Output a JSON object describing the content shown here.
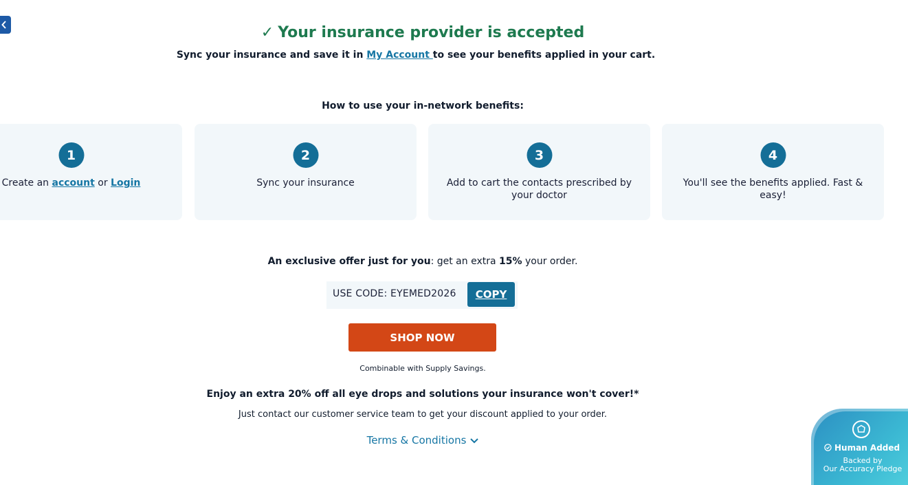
{
  "hero": {
    "check": "✓",
    "title": "Your insurance provider is accepted",
    "sub_before": "Sync your insurance and save it in ",
    "sub_link": "My Account ",
    "sub_after": "to see your benefits applied in your cart."
  },
  "how": {
    "title": "How to use your in-network benefits:",
    "steps": [
      {
        "num": "1",
        "pre": "Create an ",
        "link1": "account",
        "mid": " or ",
        "link2": "Login"
      },
      {
        "num": "2",
        "text": "Sync your insurance"
      },
      {
        "num": "3",
        "text": "Add to cart the contacts prescribed by your doctor"
      },
      {
        "num": "4",
        "text": "You'll see the benefits applied. Fast & easy!"
      }
    ]
  },
  "offer": {
    "bold1": "An exclusive offer just for you",
    "text1": ": get an extra ",
    "bold2": "15%",
    "text2": " your order.",
    "code": "USE CODE: EYEMED2026",
    "copy_label": "COPY"
  },
  "shop_label": "SHOP NOW",
  "combinable": "Combinable with Supply Savings.",
  "enjoy": "Enjoy an extra 20% off all eye drops and solutions your insurance won't cover!*",
  "contact": "Just contact our customer service team to get your discount applied to your order.",
  "terms": "Terms & Conditions",
  "badge": {
    "title": "Human Added",
    "sub1": "Backed by",
    "sub2": "Our Accuracy Pledge"
  },
  "colors": {
    "accent": "#146e97",
    "success": "#1e7a4f",
    "cta": "#d34716",
    "card_bg": "#f2f7fa"
  },
  "icons": [
    "chevron-left-icon",
    "checkmark-icon",
    "chevron-down-icon",
    "shield-icon",
    "check-circle-icon"
  ]
}
